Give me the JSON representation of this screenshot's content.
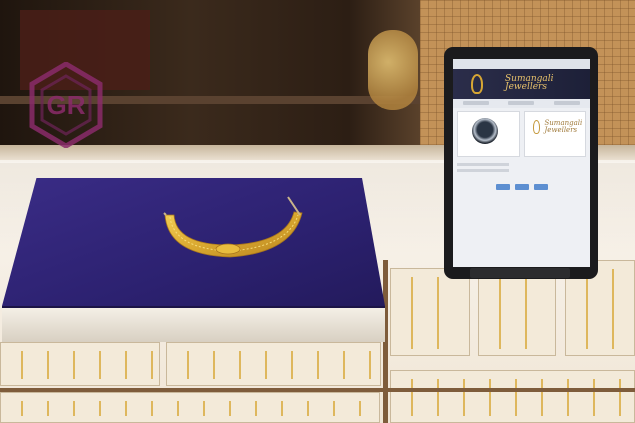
{
  "scene": {
    "description_objects": [
      "velvet-display-box",
      "gold-necklace",
      "tablet",
      "glass-counter",
      "watermark-logo"
    ]
  },
  "watermark": {
    "letters": "GR",
    "color": "#8a2b6a"
  },
  "tablet": {
    "topbar_text": "",
    "banner_brand": "Sumangali Jewellers",
    "card_brand": "Sumangali Jewellers",
    "button_count": 3
  },
  "colors": {
    "velvet": "#2c2170",
    "gold": "#d9a830",
    "tablet_accent": "#5d8fd1"
  }
}
